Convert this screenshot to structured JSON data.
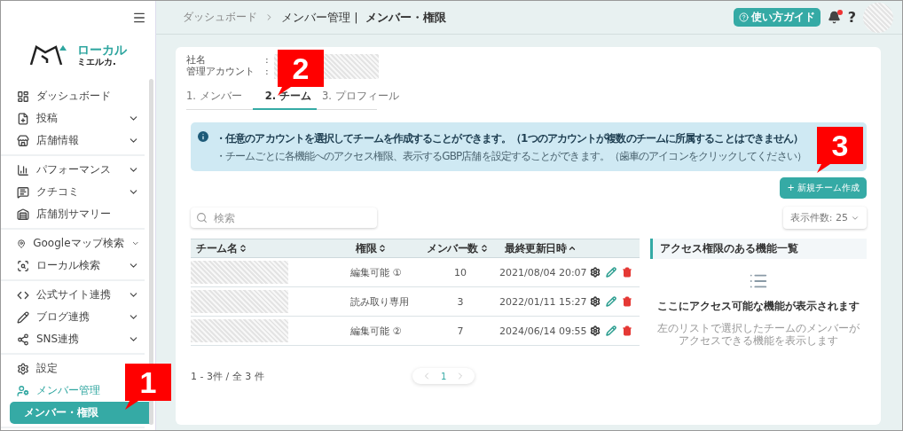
{
  "sidebar": {
    "sections": [
      {
        "items": [
          {
            "label": "ダッシュボード",
            "selected": false
          },
          {
            "label": "投稿",
            "selected": false,
            "expanded": false
          },
          {
            "label": "店舗情報",
            "selected": false,
            "expanded": false
          }
        ]
      },
      {
        "items": [
          {
            "label": "パフォーマンス",
            "selected": false,
            "expanded": false
          },
          {
            "label": "クチコミ",
            "selected": false,
            "expanded": false
          },
          {
            "label": "店舗別サマリー",
            "selected": false
          }
        ]
      },
      {
        "items": [
          {
            "label": "Googleマップ検索",
            "selected": false,
            "expanded": false
          },
          {
            "label": "ローカル検索",
            "selected": false,
            "expanded": false
          }
        ]
      },
      {
        "items": [
          {
            "label": "公式サイト連携",
            "selected": false,
            "expanded": false
          },
          {
            "label": "ブログ連携",
            "selected": false,
            "expanded": false
          },
          {
            "label": "SNS連携",
            "selected": false,
            "expanded": false
          }
        ]
      },
      {
        "items": [
          {
            "label": "設定",
            "selected": false
          },
          {
            "label": "メンバー管理",
            "selected": false,
            "expanded": true,
            "children": [
              {
                "label": "メンバー・権限",
                "selected": true
              }
            ]
          }
        ]
      }
    ]
  },
  "logo": {
    "main": "ローカル",
    "sub": "ミエルカ."
  },
  "header": {
    "breadcrumb": [
      "ダッシュボード",
      "メンバー管理 |",
      "メンバー・権限"
    ],
    "guide_button": "使い方ガイド",
    "help": "?",
    "notification_dot": true
  },
  "account": [
    {
      "label": "社名",
      "sep": ":"
    },
    {
      "label": "管理アカウント",
      "sep": ":"
    }
  ],
  "tabs": [
    {
      "label": "1. メンバー",
      "selected": false
    },
    {
      "label": "2. チーム",
      "selected": true
    },
    {
      "label": "3. プロフィール",
      "selected": false
    }
  ],
  "info": [
    "・任意のアカウントを選択してチームを作成することができます。（1つのアカウントが複数のチームに所属することはできません）",
    "・チームごとに各機能へのアクセス権限、表示するGBP店舗を設定することができます。（歯車のアイコンをクリックしてください）"
  ],
  "new_button": "+ 新規チーム作成",
  "search": {
    "placeholder": "検索"
  },
  "page_size": "表示件数: 25",
  "table": {
    "columns": [
      {
        "label": "チーム名",
        "sorted": false
      },
      {
        "label": "権限",
        "sorted": false
      },
      {
        "label": "メンバー数",
        "sorted": false
      },
      {
        "label": "最終更新日時",
        "sorted": true
      }
    ],
    "rows": [
      {
        "permission": "編集可能 ①",
        "members": "10",
        "updated": "2021/08/04 20:07"
      },
      {
        "permission": "読み取り専用",
        "members": "3",
        "updated": "2022/01/11 15:27"
      },
      {
        "permission": "編集可能 ②",
        "members": "7",
        "updated": "2024/06/14 09:55"
      }
    ]
  },
  "summary": "1 - 3件 / 全 3 件",
  "pagination": {
    "pages": [
      {
        "label": "1",
        "selected": true
      }
    ]
  },
  "access_panel": {
    "title": "アクセス権限のある機能一覧",
    "empty_title": "ここにアクセス可能な機能が表示されます",
    "empty_hint": "左のリストで選択したチームのメンバーがアクセスできる機能を表示します"
  },
  "callouts": [
    {
      "label": "1"
    },
    {
      "label": "2"
    },
    {
      "label": "3"
    }
  ]
}
